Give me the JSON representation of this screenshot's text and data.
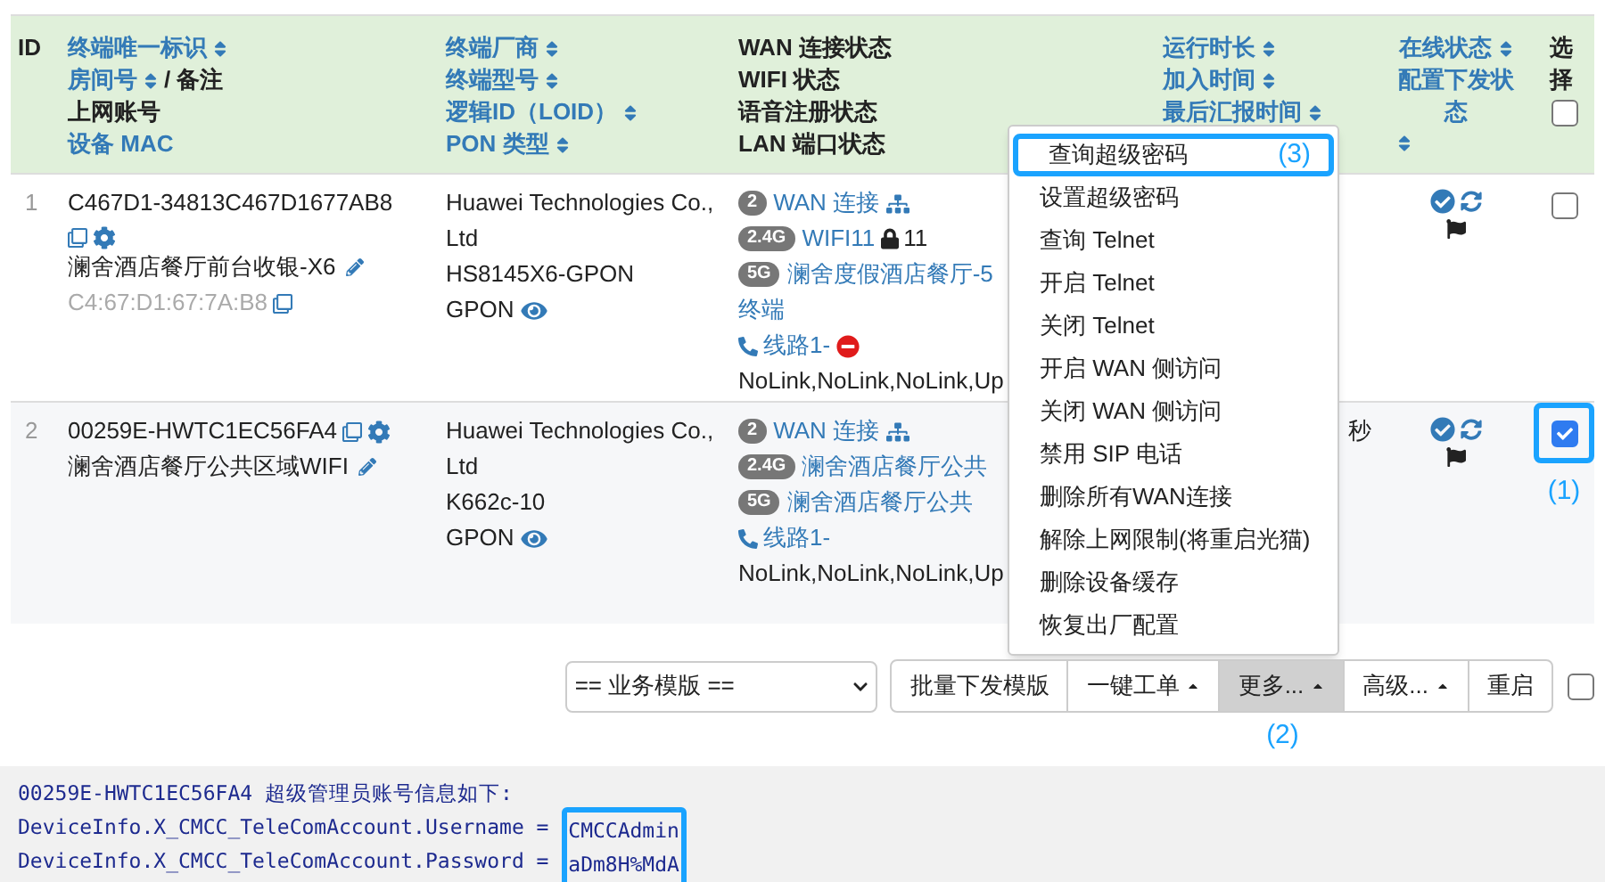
{
  "table": {
    "columns": [
      {
        "lines": [
          {
            "text": "ID",
            "link": false,
            "sort": false
          }
        ]
      },
      {
        "lines": [
          {
            "text": "终端唯一标识",
            "link": true,
            "sort": true
          },
          {
            "text": "房间号",
            "link": true,
            "sort": true,
            "suffix": "/ 备注"
          },
          {
            "text": "上网账号",
            "link": false,
            "sort": false
          },
          {
            "text": "设备 MAC",
            "link": true,
            "sort": false
          }
        ]
      },
      {
        "lines": [
          {
            "text": "终端厂商",
            "link": true,
            "sort": true
          },
          {
            "text": "终端型号",
            "link": true,
            "sort": true
          },
          {
            "text": "逻辑ID（LOID）",
            "link": true,
            "sort": true
          },
          {
            "text": "PON 类型",
            "link": true,
            "sort": true
          }
        ]
      },
      {
        "lines": [
          {
            "text": "WAN 连接状态",
            "link": false,
            "sort": false
          },
          {
            "text": "WIFI 状态",
            "link": false,
            "sort": false
          },
          {
            "text": "语音注册状态",
            "link": false,
            "sort": false
          },
          {
            "text": "LAN 端口状态",
            "link": false,
            "sort": false
          }
        ]
      },
      {
        "lines": [
          {
            "text": "运行时长",
            "link": true,
            "sort": true
          },
          {
            "text": "加入时间",
            "link": true,
            "sort": true
          },
          {
            "text": "最后汇报时间",
            "link": true,
            "sort": true
          }
        ]
      },
      {
        "lines": [
          {
            "text": "在线状态",
            "link": true,
            "sort": true
          },
          {
            "text": "配置下发状态",
            "link": true,
            "sort": true
          }
        ]
      },
      {
        "lines": [
          {
            "text": "选择",
            "link": false,
            "sort": false
          }
        ],
        "checkbox": {
          "checked": false
        }
      }
    ],
    "rows": [
      {
        "id": "1",
        "device_id": "C467D1-34813C467D1677AB8",
        "remark": "澜舍酒店餐厅前台收银-X6",
        "mac": "C4:67:D1:67:7A:B8",
        "vendor": "Huawei Technologies Co., Ltd",
        "model": "HS8145X6-GPON",
        "pon": "GPON",
        "wan_count": "2",
        "wan_label": "WAN 连接",
        "wifi": [
          {
            "band": "2.4G",
            "name": "WIFI11",
            "locked": true,
            "extra": "11"
          },
          {
            "band": "5G",
            "name": "澜舍度假酒店餐厅-5",
            "name_continued": "终端",
            "locked": false
          }
        ],
        "voice_line": "线路1-",
        "voice_error": true,
        "lan": "NoLink,NoLink,NoLink,Up",
        "selected": false,
        "highlighted": false
      },
      {
        "id": "2",
        "device_id": "00259E-HWTC1EC56FA4",
        "remark": "澜舍酒店餐厅公共区域WIFI",
        "vendor": "Huawei Technologies Co., Ltd",
        "model": "K662c-10",
        "pon": "GPON",
        "wan_count": "2",
        "wan_label": "WAN 连接",
        "wifi": [
          {
            "band": "2.4G",
            "name": "澜舍酒店餐厅公共",
            "locked": false
          },
          {
            "band": "5G",
            "name": "澜舍酒店餐厅公共",
            "locked": false
          }
        ],
        "voice_line": "线路1-",
        "voice_error": false,
        "lan": "NoLink,NoLink,NoLink,Up",
        "uptime": "秒",
        "selected": true,
        "highlighted": true,
        "annotation": "(1)"
      }
    ]
  },
  "menu": {
    "items": [
      {
        "label": "查询超级密码",
        "highlighted": true,
        "annotation": "(3)"
      },
      {
        "label": "设置超级密码",
        "highlighted": false
      },
      {
        "label": "查询 Telnet",
        "highlighted": false
      },
      {
        "label": "开启 Telnet",
        "highlighted": false
      },
      {
        "label": "关闭 Telnet",
        "highlighted": false
      },
      {
        "label": "开启 WAN 侧访问",
        "highlighted": false
      },
      {
        "label": "关闭 WAN 侧访问",
        "highlighted": false
      },
      {
        "label": "禁用 SIP 电话",
        "highlighted": false
      },
      {
        "label": "删除所有WAN连接",
        "highlighted": false
      },
      {
        "label": "解除上网限制(将重启光猫)",
        "highlighted": false
      },
      {
        "label": "删除设备缓存",
        "highlighted": false
      },
      {
        "label": "恢复出厂配置",
        "highlighted": false
      }
    ]
  },
  "toolbar": {
    "template_select": "== 业务模版 ==",
    "buttons": [
      {
        "label": "批量下发模版",
        "caret": false,
        "pressed": false
      },
      {
        "label": "一键工单",
        "caret": true,
        "pressed": false
      },
      {
        "label": "更多...",
        "caret": true,
        "pressed": true,
        "annotation": "(2)"
      },
      {
        "label": "高级...",
        "caret": true,
        "pressed": false
      },
      {
        "label": "重启",
        "caret": false,
        "pressed": false
      }
    ],
    "checkbox": {
      "checked": false
    }
  },
  "output": {
    "header": "00259E-HWTC1EC56FA4 超级管理员账号信息如下:",
    "values_highlighted": true,
    "entries": [
      {
        "key": "DeviceInfo.X_CMCC_TeleComAccount.Username =",
        "value": "CMCCAdmin"
      },
      {
        "key": "DeviceInfo.X_CMCC_TeleComAccount.Password =",
        "value": "aDm8H%MdA"
      }
    ]
  }
}
